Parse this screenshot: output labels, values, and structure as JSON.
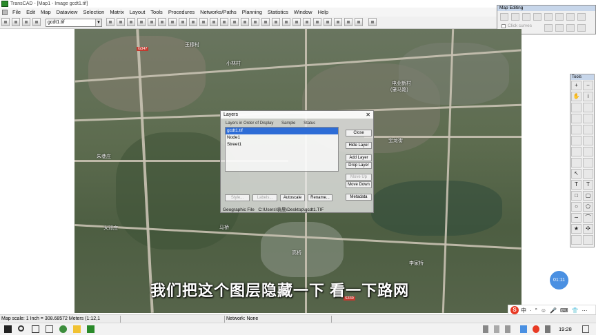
{
  "window": {
    "title": "TransCAD - [Map1 - Image gcdt1.tif]"
  },
  "menu": {
    "items": [
      "File",
      "Edit",
      "Map",
      "Dataview",
      "Selection",
      "Matrix",
      "Layout",
      "Tools",
      "Procedures",
      "Networks/Paths",
      "Planning",
      "Statistics",
      "Window",
      "Help"
    ]
  },
  "toolbar": {
    "layer_select": "gcdt1.tif"
  },
  "map_editing": {
    "title": "Map Editing",
    "click_curves_label": "Click curves"
  },
  "tools_palette": {
    "title": "Tools"
  },
  "map_labels": {
    "l1": "王穆村",
    "l2": "小林村",
    "l3": "电业新村",
    "l4": "(肇马路)",
    "l5": "宝龙街",
    "l6": "朱巷庄",
    "l7": "大邓庄",
    "l8": "马桥",
    "l9": "高桥",
    "l10": "李家桥",
    "tag1": "G347",
    "tag2": "S339"
  },
  "layers_dialog": {
    "title": "Layers",
    "col_layers": "Layers in Order of Display",
    "col_sample": "Sample",
    "col_status": "Status",
    "layers": [
      "gcdt1.tif",
      "Node1",
      "Street1"
    ],
    "selected_index": 0,
    "btn_close": "Close",
    "btn_hide": "Hide Layer",
    "btn_add": "Add Layer",
    "btn_drop": "Drop Layer",
    "btn_move_up": "Move Up",
    "btn_move_down": "Move Down",
    "btn_metadata": "Metadata",
    "btn_style": "Style...",
    "btn_labels": "Labels...",
    "btn_autoscale": "Autoscale",
    "btn_rename": "Rename...",
    "geo_label": "Geographic File",
    "geo_path": "C:\\Users\\袁晨\\Desktop\\gcdt1.TIF"
  },
  "subtitle": "我们把这个图层隐藏一下   看一下路网",
  "timer": "01:11",
  "ime": {
    "lang": "中",
    "items": [
      "·",
      "°",
      "☺",
      "🎤",
      "⌨",
      "👕",
      "⋯"
    ]
  },
  "status": {
    "scale": "Map scale: 1 Inch = 308.68572 Meters (1:12,1",
    "network": "Network: None"
  },
  "taskbar": {
    "clock": "19:28"
  },
  "colors": {
    "selection": "#2d6cd6",
    "titlebar_panel": "#c7d6ea",
    "map_base": "#5d6c4f",
    "bubble": "#4a90e2"
  }
}
